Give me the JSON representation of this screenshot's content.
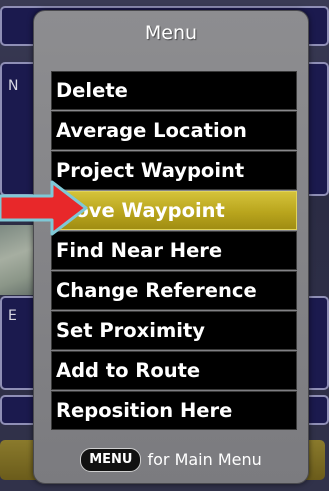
{
  "menu": {
    "title": "Menu",
    "items": [
      {
        "label": "Delete",
        "selected": false
      },
      {
        "label": "Average Location",
        "selected": false
      },
      {
        "label": "Project Waypoint",
        "selected": false
      },
      {
        "label": "Move Waypoint",
        "selected": true
      },
      {
        "label": "Find Near Here",
        "selected": false
      },
      {
        "label": "Change Reference",
        "selected": false
      },
      {
        "label": "Set Proximity",
        "selected": false
      },
      {
        "label": "Add to Route",
        "selected": false
      },
      {
        "label": "Reposition Here",
        "selected": false
      }
    ],
    "footer": {
      "key_label": "MENU",
      "text": "for Main Menu"
    }
  },
  "background": {
    "letters": [
      "N",
      "E"
    ]
  },
  "colors": {
    "popup_bg": "#858588",
    "item_bg": "#000000",
    "selected_bg": "#c2ae22",
    "callout_arrow": "#e8282a",
    "callout_outline": "#7fc8d6"
  },
  "icons": {
    "callout": "right-arrow-icon"
  }
}
